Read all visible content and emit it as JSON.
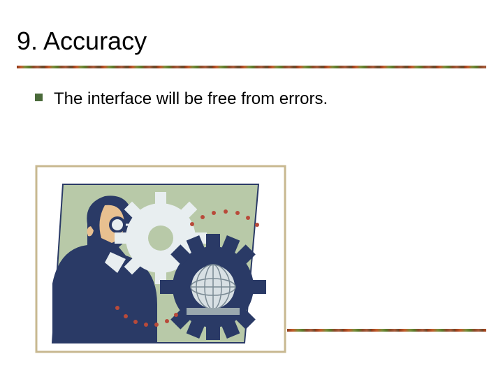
{
  "slide": {
    "title": "9. Accuracy",
    "bullets": [
      {
        "text": "The interface will be free from errors."
      }
    ]
  },
  "colors": {
    "bullet": "#4a6a3a",
    "accent_border": "#8b5a2a"
  },
  "clipart": {
    "description": "man-with-gears-and-globe",
    "bg": "#b8c9a8",
    "man_color": "#2a3a66",
    "skin_color": "#e8c090",
    "gear_light": "#e8eef0",
    "gear_dark": "#2a3a66",
    "dot_color": "#b84a3a"
  }
}
